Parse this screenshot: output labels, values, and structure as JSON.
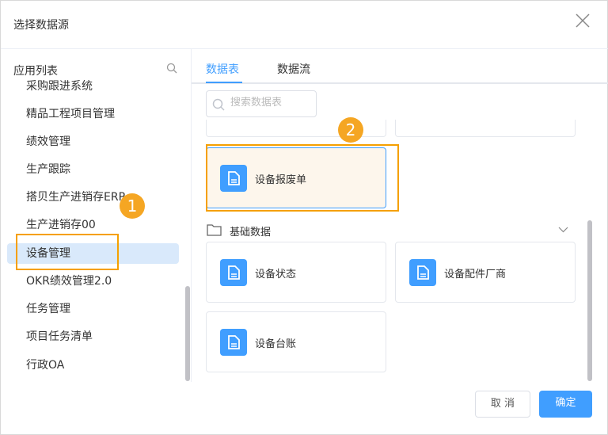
{
  "dialog": {
    "title": "选择数据源"
  },
  "left": {
    "title": "应用列表",
    "items": [
      {
        "label": "采购跟进系统"
      },
      {
        "label": "精品工程项目管理"
      },
      {
        "label": "绩效管理"
      },
      {
        "label": "生产跟踪"
      },
      {
        "label": "搭贝生产进销存ERP"
      },
      {
        "label": "生产进销存00"
      },
      {
        "label": "设备管理",
        "selected": true
      },
      {
        "label": "OKR绩效管理2.0"
      },
      {
        "label": "任务管理"
      },
      {
        "label": "项目任务清单"
      },
      {
        "label": "行政OA"
      }
    ]
  },
  "tabs": [
    {
      "label": "数据表",
      "active": true
    },
    {
      "label": "数据流"
    }
  ],
  "search": {
    "placeholder": "搜索数据表",
    "value": ""
  },
  "highlighted_card": {
    "label": "设备报废单"
  },
  "group": {
    "label": "基础数据",
    "cards": [
      {
        "label": "设备状态"
      },
      {
        "label": "设备配件厂商"
      },
      {
        "label": "设备台账"
      }
    ]
  },
  "annotations": {
    "badge1": "1",
    "badge2": "2"
  },
  "footer": {
    "cancel": "取 消",
    "confirm": "确定"
  },
  "colors": {
    "accent": "#409eff",
    "annotation": "#f5a623",
    "selected_bg": "#d9e9fb"
  }
}
